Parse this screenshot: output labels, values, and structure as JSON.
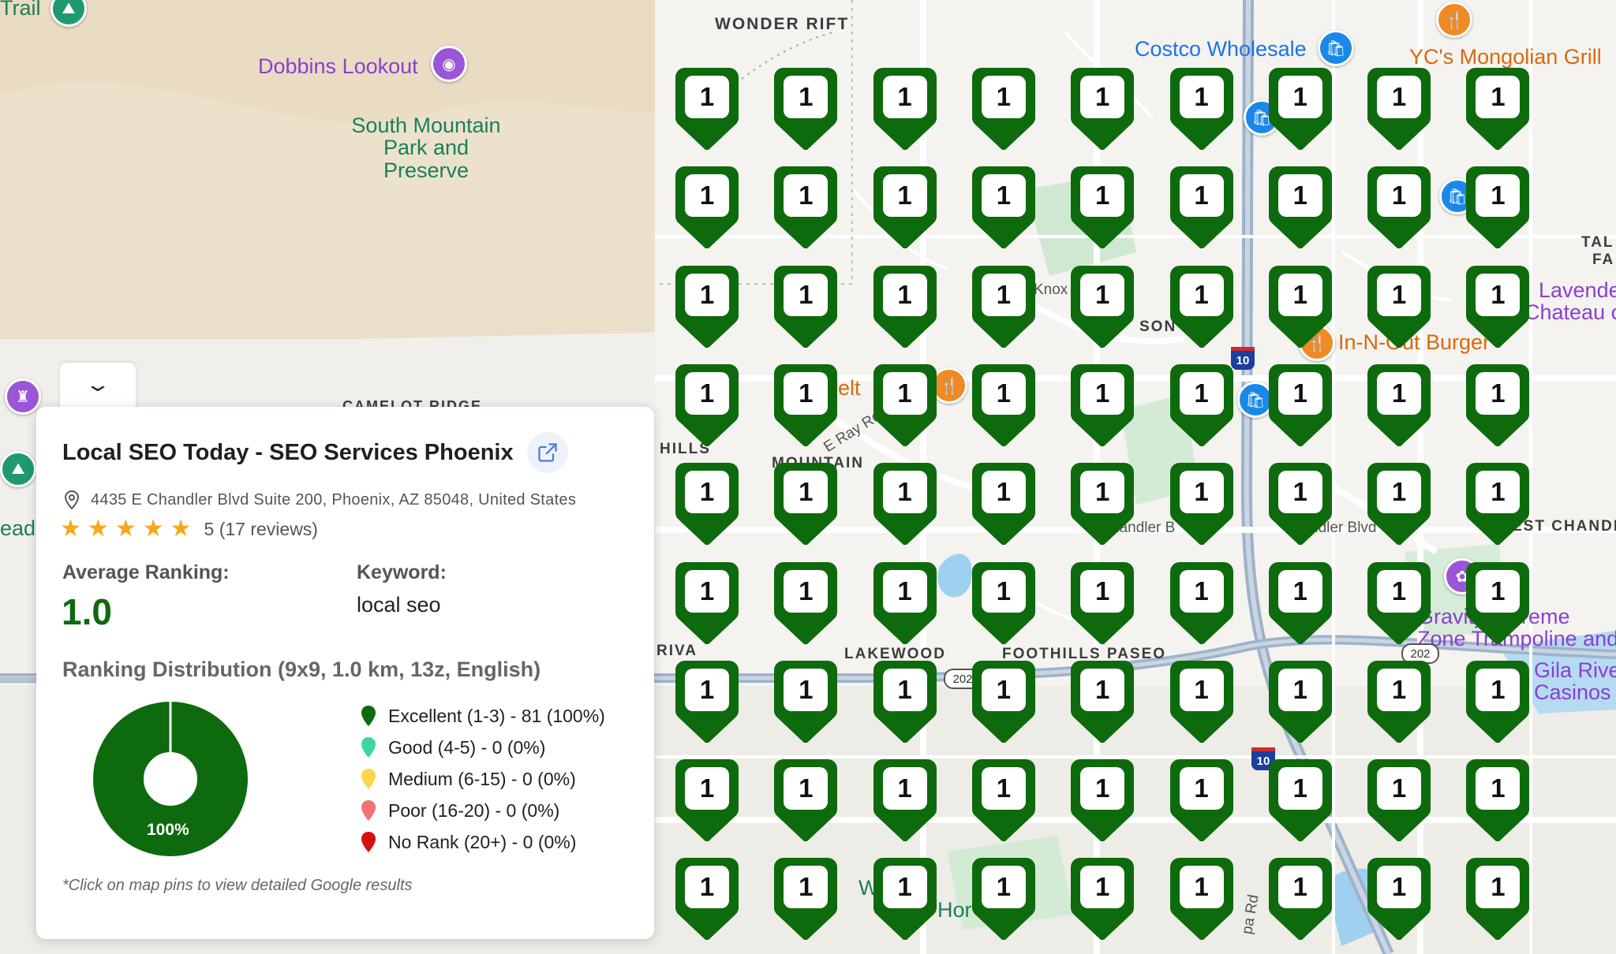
{
  "colors": {
    "pin_excellent": "#0d6a0d",
    "good": "#3ed6a0",
    "medium": "#ffd54a",
    "poor": "#f27272",
    "no_rank": "#d60f0f"
  },
  "map": {
    "labels": {
      "trail": "Trail",
      "dobbins_lookout": "Dobbins Lookout",
      "south_mountain_park": "South Mountain Park and Preserve",
      "wonder_rift": "WONDER RIFT",
      "costco": "Costco Wholesale",
      "ycs_mongolian": "YC's Mongolian Grill",
      "camelot_ridge": "CAMELOT RIDGE",
      "lead": "ead",
      "in_n_out": "In-N-Out Burger",
      "lakewood": "LAKEWOOD",
      "foothills_paseo": "FOOTHILLS PASEO",
      "riva": "RIVA",
      "gravity": "Gravity Extreme",
      "zone_trampoline": "Zone Trampoline and",
      "gila_river": "Gila River",
      "casinos": "Casinos",
      "lavender": "Lavende",
      "chateau": "Chateau c",
      "tal": "TAL",
      "fa": "FA",
      "west_chandler": "EST CHANDLER",
      "chandler_blvd_1": "handler B",
      "chandler_blvd_2": "ndler Blvd",
      "e_ray_rd": "E Ray Rd",
      "knox": "Knox",
      "soneo": "SON",
      "elt": "elt",
      "mountain": "MOUNTAIN",
      "hills": "HILLS",
      "w_and_g": "W",
      "hor": "Hor",
      "pa_rd": "pa Rd",
      "route_10": "10",
      "route_202": "202"
    }
  },
  "grid": {
    "rows": 9,
    "cols": 9,
    "ranks": [
      [
        1,
        1,
        1,
        1,
        1,
        1,
        1,
        1,
        1
      ],
      [
        1,
        1,
        1,
        1,
        1,
        1,
        1,
        1,
        1
      ],
      [
        1,
        1,
        1,
        1,
        1,
        1,
        1,
        1,
        1
      ],
      [
        1,
        1,
        1,
        1,
        1,
        1,
        1,
        1,
        1
      ],
      [
        1,
        1,
        1,
        1,
        1,
        1,
        1,
        1,
        1
      ],
      [
        1,
        1,
        1,
        1,
        1,
        1,
        1,
        1,
        1
      ],
      [
        1,
        1,
        1,
        1,
        1,
        1,
        1,
        1,
        1
      ],
      [
        1,
        1,
        1,
        1,
        1,
        1,
        1,
        1,
        1
      ],
      [
        1,
        1,
        1,
        1,
        1,
        1,
        1,
        1,
        1
      ]
    ]
  },
  "panel": {
    "collapse_icon": "chevron-down-icon",
    "business_name": "Local SEO Today - SEO Services Phoenix",
    "external_link_icon": "external-link-icon",
    "address": "4435 E Chandler Blvd Suite 200, Phoenix, AZ 85048, United States",
    "rating": 5,
    "rating_text": "5 (17 reviews)",
    "avg_ranking_label": "Average Ranking:",
    "avg_ranking_value": "1.0",
    "keyword_label": "Keyword:",
    "keyword_value": "local seo",
    "distribution_title": "Ranking Distribution (9x9, 1.0 km, 13z, English)",
    "donut_percent": 100,
    "donut_label": "100%",
    "legend": [
      {
        "label": "Excellent (1-3) - 81 (100%)",
        "color": "#0d6a0d"
      },
      {
        "label": "Good (4-5) - 0 (0%)",
        "color": "#3ed6a0"
      },
      {
        "label": "Medium (6-15) - 0 (0%)",
        "color": "#ffd54a"
      },
      {
        "label": "Poor (16-20) - 0 (0%)",
        "color": "#f27272"
      },
      {
        "label": "No Rank (20+) - 0 (0%)",
        "color": "#d60f0f"
      }
    ],
    "note": "*Click on map pins to view detailed Google results"
  }
}
